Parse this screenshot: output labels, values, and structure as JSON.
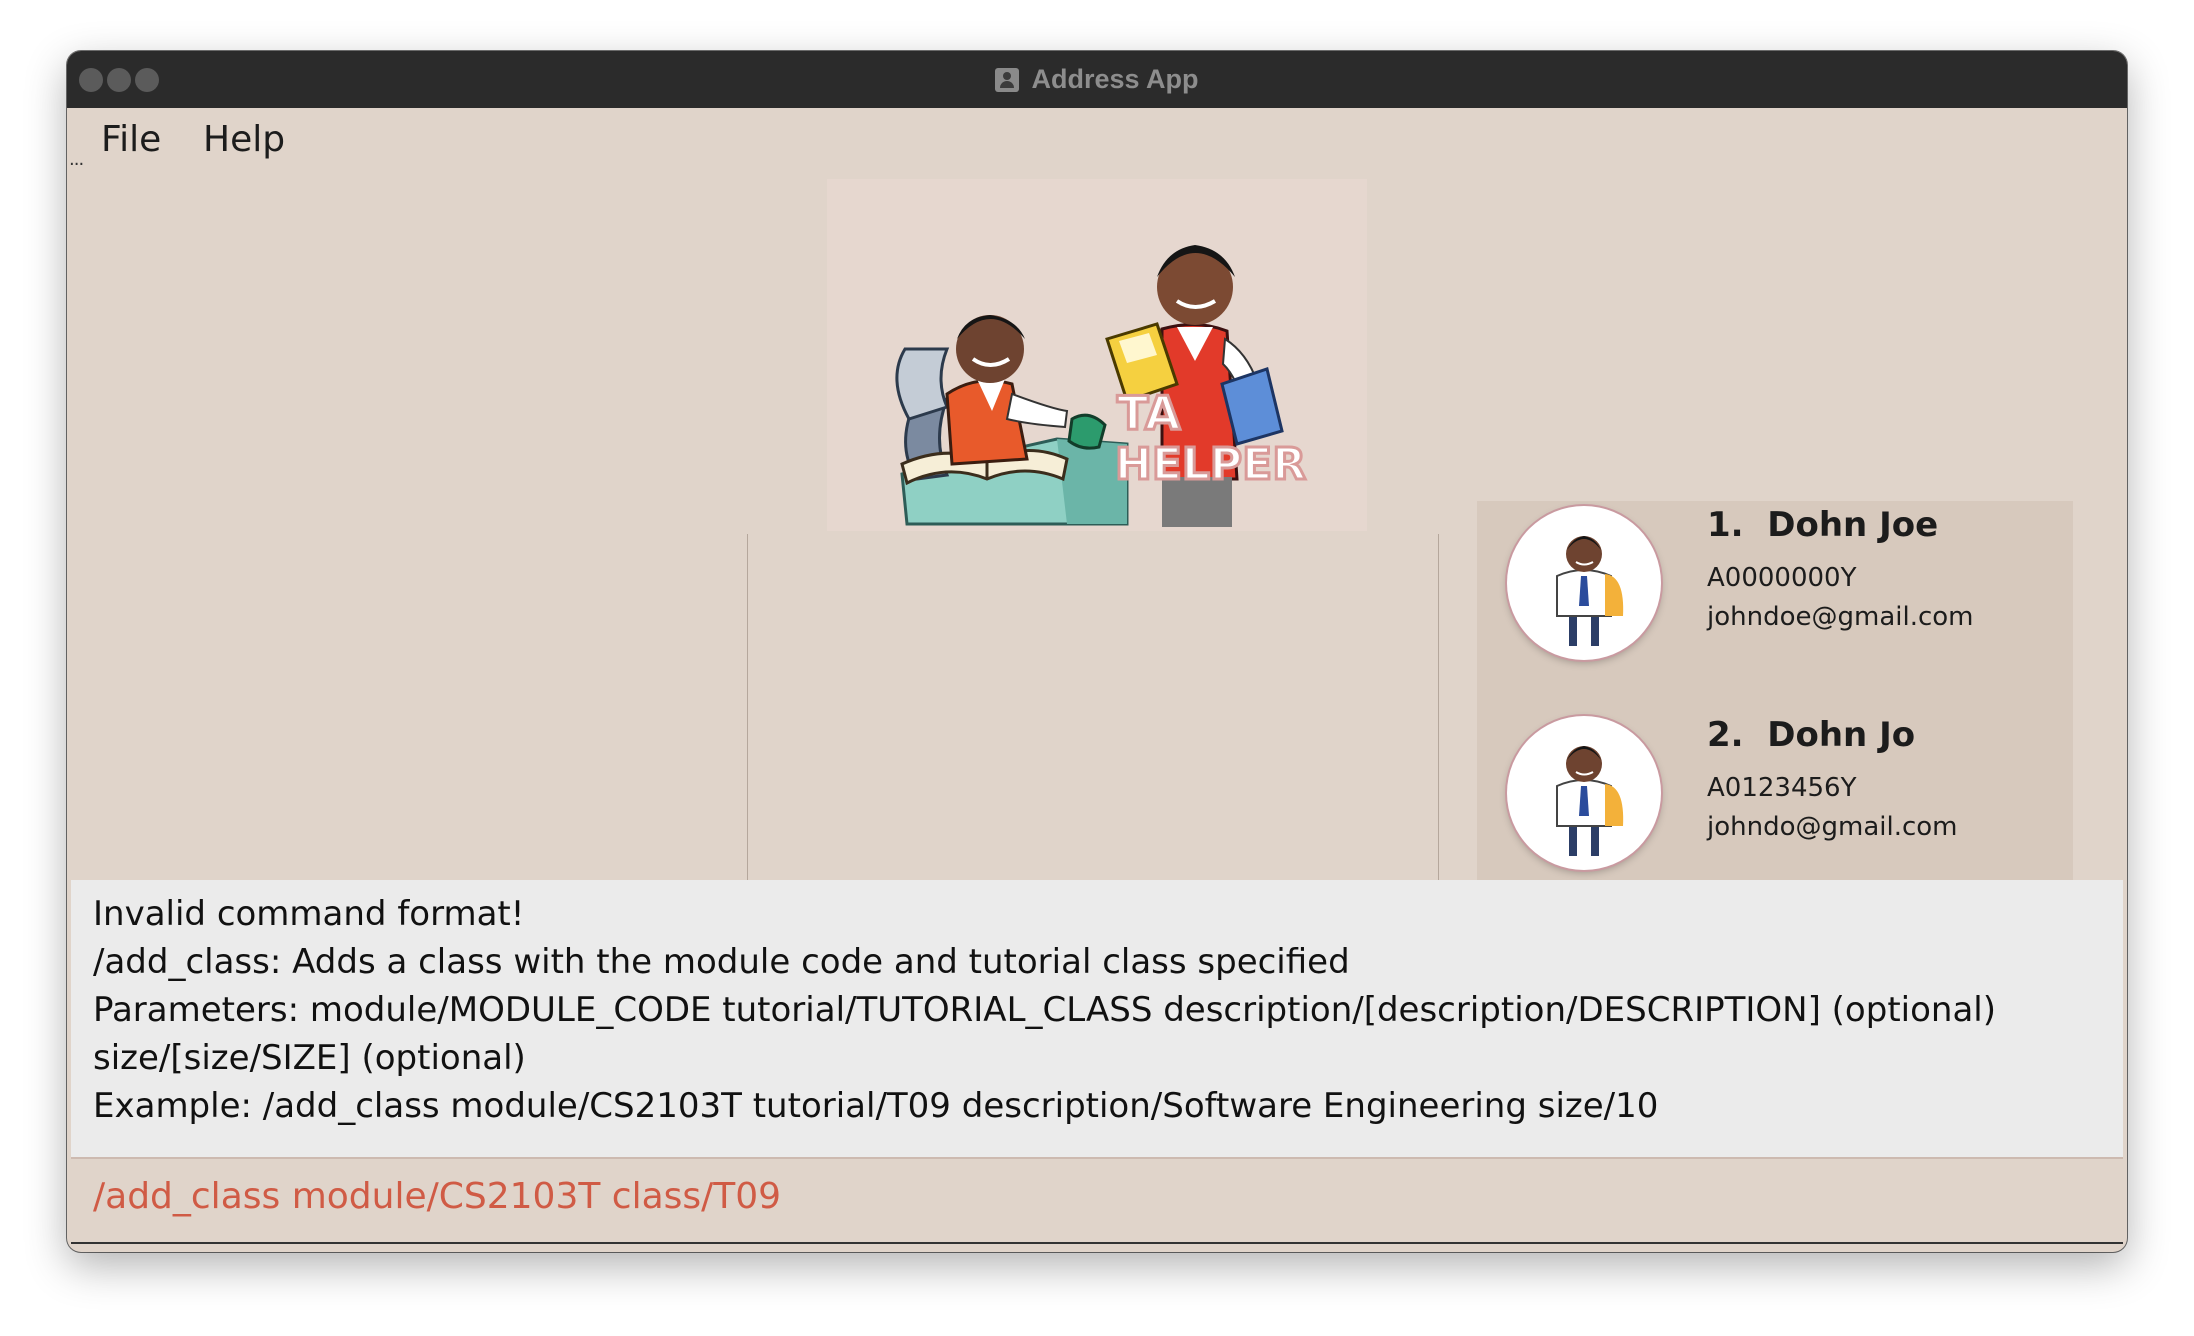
{
  "window": {
    "title": "Address App"
  },
  "menu": {
    "items": [
      "File",
      "Help"
    ]
  },
  "logo": {
    "text_line1": "TA",
    "text_line2": "HELPER"
  },
  "persons": [
    {
      "index": "1.",
      "name": "Dohn Joe",
      "student_id": "A0000000Y",
      "email": "johndoe@gmail.com"
    },
    {
      "index": "2.",
      "name": "Dohn Jo",
      "student_id": "A0123456Y",
      "email": "johndo@gmail.com"
    }
  ],
  "result": {
    "lines": [
      "Invalid command format!",
      "/add_class: Adds a class with the module code and tutorial class specified",
      "Parameters: module/MODULE_CODE tutorial/TUTORIAL_CLASS description/[description/DESCRIPTION] (optional)",
      "size/[size/SIZE] (optional)",
      "Example: /add_class module/CS2103T tutorial/T09 description/Software Engineering size/10"
    ]
  },
  "command": {
    "value": "/add_class module/CS2103T class/T09"
  },
  "colors": {
    "background": "#e0d4ca",
    "titlebar": "#2b2b2b",
    "command_text": "#d05b45",
    "result_background": "#ebebeb",
    "card_background": "#d7c9bd"
  }
}
